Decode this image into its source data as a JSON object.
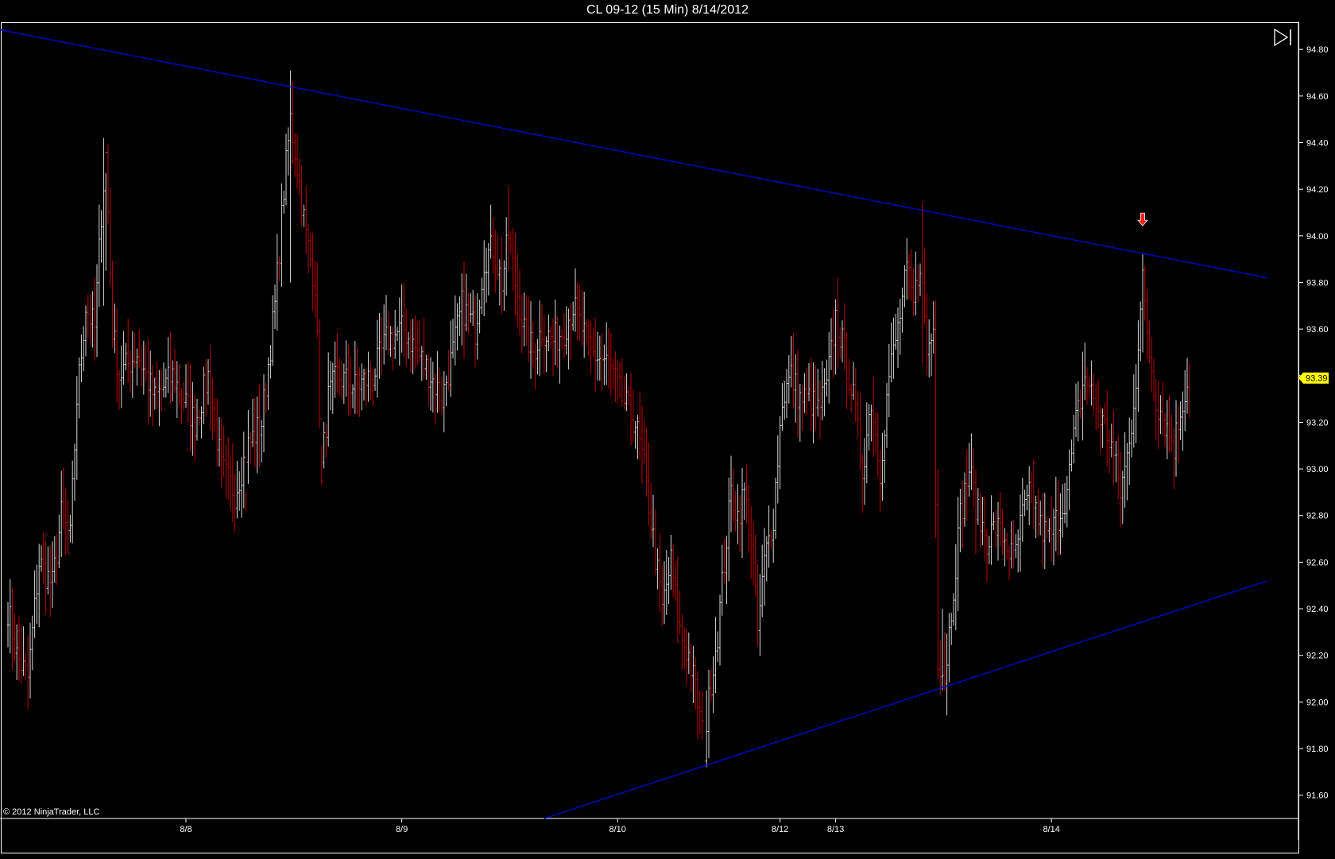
{
  "title": "CL 09-12 (15 Min)  8/14/2012",
  "copyright": "© 2012 NinjaTrader, LLC",
  "colors": {
    "background": "#000000",
    "bar_up": "#d8d8d8",
    "bar_down": "#c00000",
    "trendline": "#0000cc",
    "axis": "#ffffff",
    "price_marker_bg": "#ffff00",
    "arrow": "#ff2020"
  },
  "chart_data": {
    "type": "ohlc",
    "instrument": "CL 09-12",
    "interval": "15 Min",
    "ylim": [
      91.5,
      94.92
    ],
    "y_ticks": [
      91.6,
      91.8,
      92.0,
      92.2,
      92.4,
      92.6,
      92.8,
      93.0,
      93.2,
      93.4,
      93.6,
      93.8,
      94.0,
      94.2,
      94.4,
      94.6,
      94.8
    ],
    "x_ticks": [
      {
        "label": "8/8",
        "index": 80
      },
      {
        "label": "8/9",
        "index": 177
      },
      {
        "label": "8/10",
        "index": 274
      },
      {
        "label": "8/12",
        "index": 347
      },
      {
        "label": "8/13",
        "index": 372
      },
      {
        "label": "8/14",
        "index": 469
      }
    ],
    "bar_count": 532,
    "current_price": "93.39",
    "current_price_value": 93.39,
    "anchors": [
      [
        0,
        92.4
      ],
      [
        4,
        92.2
      ],
      [
        9,
        92.1
      ],
      [
        14,
        92.6
      ],
      [
        20,
        92.5
      ],
      [
        24,
        92.8
      ],
      [
        28,
        92.7
      ],
      [
        31,
        93.3
      ],
      [
        35,
        93.7
      ],
      [
        39,
        93.6
      ],
      [
        42,
        94.1
      ],
      [
        44,
        94.35
      ],
      [
        47,
        93.6
      ],
      [
        50,
        93.4
      ],
      [
        58,
        93.5
      ],
      [
        66,
        93.3
      ],
      [
        74,
        93.4
      ],
      [
        84,
        93.2
      ],
      [
        90,
        93.4
      ],
      [
        96,
        93.0
      ],
      [
        102,
        92.9
      ],
      [
        108,
        93.1
      ],
      [
        114,
        93.2
      ],
      [
        120,
        93.7
      ],
      [
        124,
        94.2
      ],
      [
        127,
        94.5
      ],
      [
        130,
        94.3
      ],
      [
        134,
        94.0
      ],
      [
        138,
        93.8
      ],
      [
        141,
        93.0
      ],
      [
        144,
        93.3
      ],
      [
        148,
        93.4
      ],
      [
        156,
        93.35
      ],
      [
        164,
        93.4
      ],
      [
        170,
        93.55
      ],
      [
        178,
        93.6
      ],
      [
        184,
        93.5
      ],
      [
        190,
        93.4
      ],
      [
        195,
        93.3
      ],
      [
        200,
        93.5
      ],
      [
        204,
        93.7
      ],
      [
        210,
        93.6
      ],
      [
        214,
        93.9
      ],
      [
        218,
        93.95
      ],
      [
        222,
        93.8
      ],
      [
        225,
        94.0
      ],
      [
        228,
        93.8
      ],
      [
        232,
        93.6
      ],
      [
        236,
        93.5
      ],
      [
        240,
        93.6
      ],
      [
        245,
        93.55
      ],
      [
        250,
        93.6
      ],
      [
        254,
        93.7
      ],
      [
        258,
        93.6
      ],
      [
        262,
        93.5
      ],
      [
        270,
        93.45
      ],
      [
        276,
        93.3
      ],
      [
        282,
        93.2
      ],
      [
        286,
        93.0
      ],
      [
        290,
        92.7
      ],
      [
        294,
        92.4
      ],
      [
        298,
        92.6
      ],
      [
        302,
        92.3
      ],
      [
        306,
        92.2
      ],
      [
        310,
        92.0
      ],
      [
        313,
        91.8
      ],
      [
        316,
        92.1
      ],
      [
        319,
        92.3
      ],
      [
        322,
        92.6
      ],
      [
        325,
        92.9
      ],
      [
        328,
        92.8
      ],
      [
        331,
        92.9
      ],
      [
        334,
        92.7
      ],
      [
        337,
        92.3
      ],
      [
        340,
        92.6
      ],
      [
        344,
        92.8
      ],
      [
        348,
        93.3
      ],
      [
        352,
        93.4
      ],
      [
        356,
        93.3
      ],
      [
        360,
        93.3
      ],
      [
        364,
        93.25
      ],
      [
        368,
        93.35
      ],
      [
        372,
        93.65
      ],
      [
        376,
        93.5
      ],
      [
        380,
        93.3
      ],
      [
        384,
        93.0
      ],
      [
        388,
        93.3
      ],
      [
        392,
        93.0
      ],
      [
        396,
        93.4
      ],
      [
        400,
        93.6
      ],
      [
        404,
        93.85
      ],
      [
        407,
        93.7
      ],
      [
        410,
        93.9
      ],
      [
        413,
        93.5
      ],
      [
        416,
        93.6
      ],
      [
        418,
        92.2
      ],
      [
        421,
        92.1
      ],
      [
        424,
        92.4
      ],
      [
        428,
        92.8
      ],
      [
        432,
        93.0
      ],
      [
        436,
        92.8
      ],
      [
        440,
        92.7
      ],
      [
        444,
        92.75
      ],
      [
        448,
        92.7
      ],
      [
        452,
        92.6
      ],
      [
        456,
        92.8
      ],
      [
        460,
        92.9
      ],
      [
        464,
        92.75
      ],
      [
        468,
        92.7
      ],
      [
        472,
        92.8
      ],
      [
        476,
        92.9
      ],
      [
        480,
        93.2
      ],
      [
        484,
        93.4
      ],
      [
        488,
        93.3
      ],
      [
        492,
        93.2
      ],
      [
        496,
        93.1
      ],
      [
        500,
        92.9
      ],
      [
        504,
        93.1
      ],
      [
        507,
        93.4
      ],
      [
        510,
        93.8
      ],
      [
        513,
        93.5
      ],
      [
        516,
        93.3
      ],
      [
        520,
        93.2
      ],
      [
        524,
        93.1
      ],
      [
        528,
        93.3
      ],
      [
        531,
        93.39
      ]
    ],
    "highlights": [
      {
        "index": 43,
        "high": 94.42,
        "low": 93.7
      },
      {
        "index": 44,
        "high": 94.27,
        "low": 93.85
      },
      {
        "index": 127,
        "high": 94.71,
        "low": 93.8
      },
      {
        "index": 225,
        "high": 94.21,
        "low": 93.85
      },
      {
        "index": 313,
        "high": 91.73,
        "low": 91.73
      },
      {
        "index": 314,
        "high": 92.05,
        "low": 91.72
      },
      {
        "index": 411,
        "high": 94.14,
        "low": 93.45
      },
      {
        "index": 418,
        "high": 93.0,
        "low": 92.1
      },
      {
        "index": 420,
        "high": 92.4,
        "low": 92.05
      },
      {
        "index": 421,
        "high": 92.3,
        "low": 92.05
      },
      {
        "index": 510,
        "high": 93.92,
        "low": 93.5
      },
      {
        "index": 141,
        "high": 93.1,
        "low": 92.93
      },
      {
        "index": 107,
        "high": 92.9,
        "low": 92.82
      }
    ],
    "trendlines": [
      {
        "start": [
          -12,
          94.9
        ],
        "end": [
          566,
          93.82
        ]
      },
      {
        "start": [
          241,
          91.5
        ],
        "end": [
          566,
          92.52
        ]
      }
    ],
    "arrow": {
      "index": 510,
      "price": 94.05,
      "direction": "down"
    }
  }
}
